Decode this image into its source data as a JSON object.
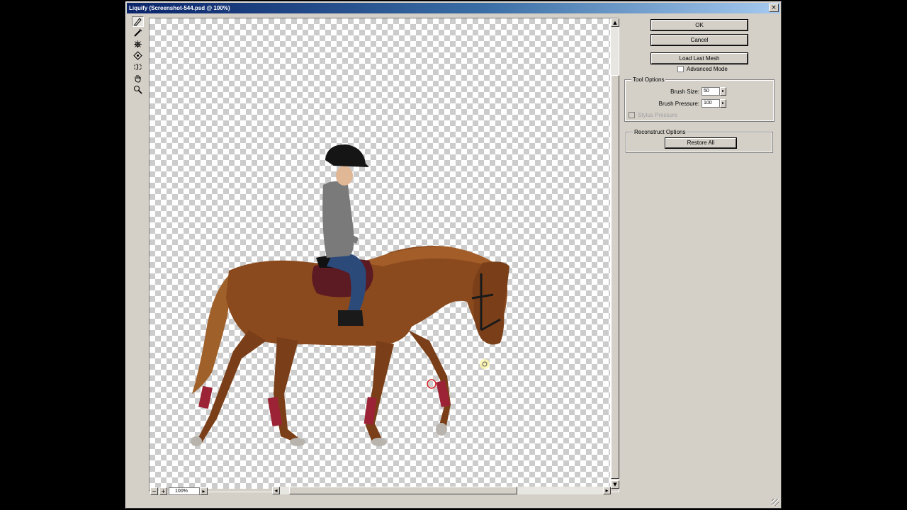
{
  "window": {
    "title": "Liquify (Screenshot-544.psd @ 100%)",
    "close": "×"
  },
  "tools": [
    {
      "name": "forward-warp-tool-icon",
      "active": true
    },
    {
      "name": "reconstruct-tool-icon",
      "active": false
    },
    {
      "name": "pucker-tool-icon",
      "active": false
    },
    {
      "name": "bloat-tool-icon",
      "active": false
    },
    {
      "name": "push-left-tool-icon",
      "active": false
    },
    {
      "name": "hand-tool-icon",
      "active": false
    },
    {
      "name": "zoom-tool-icon",
      "active": false
    }
  ],
  "buttons": {
    "ok": "OK",
    "cancel": "Cancel",
    "load_last_mesh": "Load Last Mesh",
    "restore_all": "Restore All"
  },
  "advanced_mode": {
    "label": "Advanced Mode",
    "checked": false
  },
  "tool_options": {
    "title": "Tool Options",
    "brush_size_label": "Brush Size:",
    "brush_size": "50",
    "brush_pressure_label": "Brush Pressure:",
    "brush_pressure": "100",
    "stylus_pressure_label": "Stylus Pressure"
  },
  "reconstruct_options": {
    "title": "Reconstruct Options"
  },
  "status": {
    "zoom": "100%",
    "zoom_out": "−",
    "zoom_in": "+"
  },
  "colors": {
    "titlebar_start": "#0a246a",
    "titlebar_end": "#a6caf0",
    "dialog_bg": "#d4d0c8",
    "horse_coat": "#8b4a1e",
    "leg_wraps": "#9b2335",
    "brush_cursor": "#d81e1e"
  }
}
